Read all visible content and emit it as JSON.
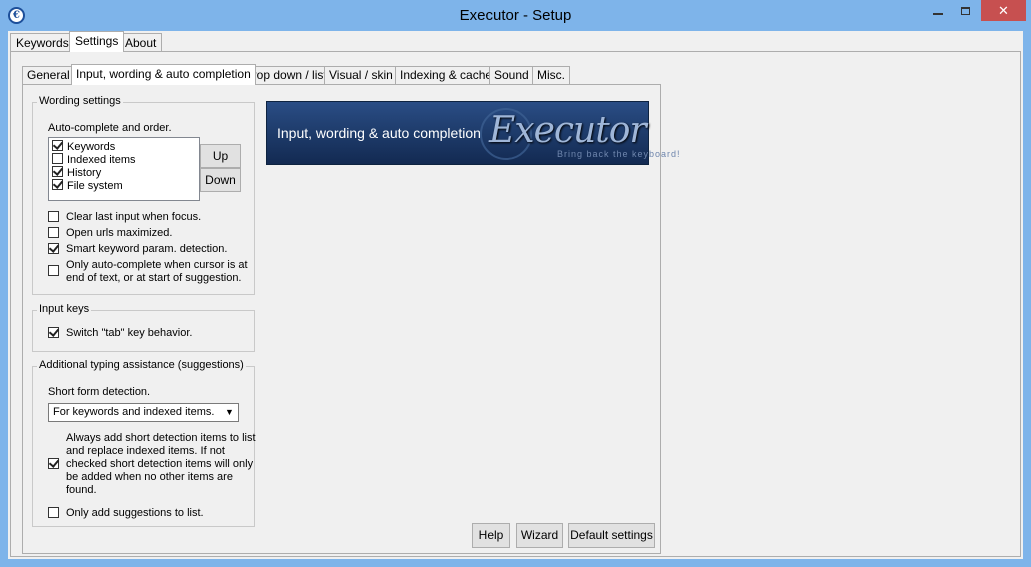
{
  "window": {
    "title": "Executor - Setup",
    "close_glyph": "✕"
  },
  "top_tabs": [
    {
      "label": "Keywords"
    },
    {
      "label": "Settings"
    },
    {
      "label": "About"
    }
  ],
  "sub_tabs": [
    {
      "label": "General"
    },
    {
      "label": "Input, wording & auto completion"
    },
    {
      "label": "Drop down / list"
    },
    {
      "label": "Visual / skin"
    },
    {
      "label": "Indexing & cache"
    },
    {
      "label": "Sound"
    },
    {
      "label": "Misc."
    }
  ],
  "wording": {
    "legend": "Wording settings",
    "order_label": "Auto-complete and order.",
    "items": [
      {
        "label": "Keywords",
        "checked": true
      },
      {
        "label": "Indexed items",
        "checked": false
      },
      {
        "label": "History",
        "checked": true
      },
      {
        "label": "File system",
        "checked": true
      }
    ],
    "up_label": "Up",
    "down_label": "Down",
    "clear_last": {
      "label": "Clear last input when focus.",
      "checked": false
    },
    "open_urls": {
      "label": "Open urls maximized.",
      "checked": false
    },
    "smart_keyword": {
      "label": "Smart keyword param. detection.",
      "checked": true
    },
    "only_autocomplete": {
      "line1": "Only auto-complete when cursor is at",
      "line2": "end of text, or at start of suggestion.",
      "checked": false
    }
  },
  "input_keys": {
    "legend": "Input keys",
    "switch_tab": {
      "label": "Switch \"tab\" key behavior.",
      "checked": true
    }
  },
  "typing": {
    "legend": "Additional typing assistance (suggestions)",
    "short_form_label": "Short form detection.",
    "short_form_value": "For keywords and indexed items.",
    "always_add": {
      "line1": "Always add short detection items to list",
      "line2": "and replace indexed items. If not",
      "line3": "checked short detection items will only",
      "line4": "be added when no other items are",
      "line5": "found.",
      "checked": true
    },
    "only_suggestions": {
      "label": "Only add suggestions to list.",
      "checked": false
    }
  },
  "banner": {
    "text": "Input, wording & auto completion",
    "logo": "Executor",
    "tagline": "Bring back the keyboard!"
  },
  "buttons": {
    "help": "Help",
    "wizard": "Wizard",
    "defaults": "Default settings"
  }
}
